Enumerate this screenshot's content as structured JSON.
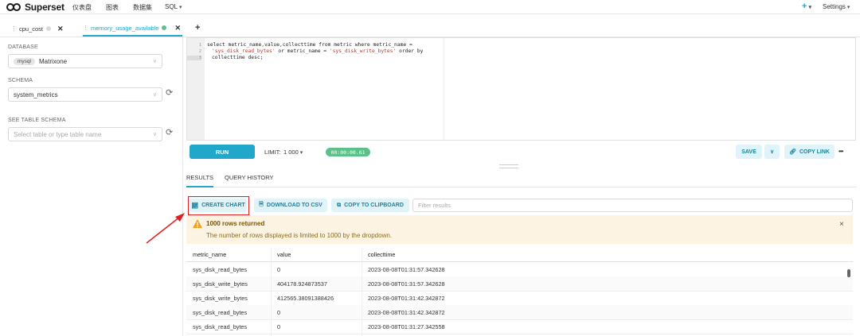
{
  "nav": {
    "brand": "Superset",
    "items": [
      "仪表盘",
      "图表",
      "数据集",
      "SQL"
    ],
    "plus": "+",
    "settings": "Settings"
  },
  "tabs": [
    {
      "label": "cpu_cost",
      "status_color": "#d9d9d9",
      "active": false
    },
    {
      "label": "memory_usage_available",
      "status_color": "#5ac189",
      "active": true
    }
  ],
  "add_tab": "+",
  "left": {
    "database_label": "DATABASE",
    "database_engine": "mysql",
    "database_value": "Matrixone",
    "schema_label": "SCHEMA",
    "schema_value": "system_metrics",
    "table_schema_label": "SEE TABLE SCHEMA",
    "table_placeholder": "Select table or type table name"
  },
  "editor": {
    "line_numbers": [
      "1",
      "2",
      "3"
    ],
    "line1": "select metric_name,value,collecttime from metric where metric_name =",
    "line2_str1": "'sys_disk_read_bytes'",
    "line2_mid": " or metric_name = ",
    "line2_str2": "'sys_disk_write_bytes'",
    "line2_end": " order by",
    "line3": "collecttime desc;"
  },
  "toolbar": {
    "run": "RUN",
    "limit": "LIMIT:",
    "limit_value": "1 000",
    "timer": "00:00:00.61",
    "save": "SAVE",
    "copy_link": "COPY LINK",
    "more": "•••"
  },
  "results": {
    "tab_results": "RESULTS",
    "tab_history": "QUERY HISTORY",
    "create_chart": "CREATE CHART",
    "download_csv": "DOWNLOAD TO CSV",
    "copy_clipboard": "COPY TO CLIPBOARD",
    "filter_placeholder": "Filter results",
    "alert_title": "1000 rows returned",
    "alert_body": "The number of rows displayed is limited to 1000 by the dropdown.",
    "alert_close": "×",
    "columns": [
      "metric_name",
      "value",
      "collecttime"
    ],
    "rows": [
      [
        "sys_disk_read_bytes",
        "0",
        "2023-08-08T01:31:57.342628"
      ],
      [
        "sys_disk_write_bytes",
        "404178.924873537",
        "2023-08-08T01:31:57.342628"
      ],
      [
        "sys_disk_write_bytes",
        "412565.38091388426",
        "2023-08-08T01:31:42.342872"
      ],
      [
        "sys_disk_read_bytes",
        "0",
        "2023-08-08T01:31:42.342872"
      ],
      [
        "sys_disk_read_bytes",
        "0",
        "2023-08-08T01:31:27.342558"
      ]
    ]
  },
  "colors": {
    "accent": "#20a7c9",
    "success": "#5ac189",
    "annotation_red": "#e02020"
  }
}
